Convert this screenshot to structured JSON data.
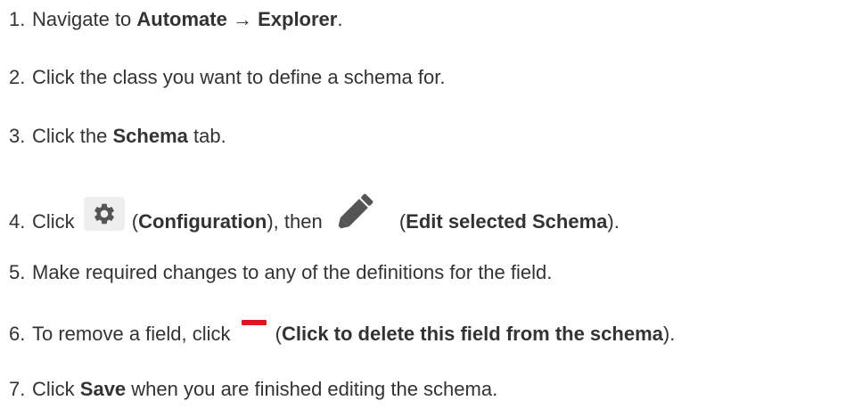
{
  "steps": [
    {
      "number": "1.",
      "prefix": "Navigate to ",
      "bold1": "Automate",
      "arrow": " → ",
      "bold2": "Explorer",
      "suffix": "."
    },
    {
      "number": "2.",
      "text": "Click the class you want to define a schema for."
    },
    {
      "number": "3.",
      "prefix": "Click the ",
      "bold": "Schema",
      "suffix": " tab."
    },
    {
      "number": "4.",
      "prefix": "Click",
      "paren_open1": "(",
      "bold1": "Configuration",
      "middle": "), then",
      "paren_open2": "(",
      "bold2": "Edit selected Schema",
      "suffix": ").",
      "icon1": "gear-icon",
      "icon2": "pencil-icon"
    },
    {
      "number": "5.",
      "text": "Make required changes to any of the definitions for the field."
    },
    {
      "number": "6.",
      "prefix": "To remove a field, click",
      "paren_open": "(",
      "bold": "Click to delete this field from the schema",
      "suffix": ").",
      "icon": "minus-icon"
    },
    {
      "number": "7.",
      "prefix": "Click ",
      "bold": "Save",
      "suffix": " when you are finished editing the schema."
    }
  ],
  "colors": {
    "text": "#333333",
    "icon_gray": "#555555",
    "icon_bg": "#eeeeee",
    "delete_red": "#e1161a"
  }
}
